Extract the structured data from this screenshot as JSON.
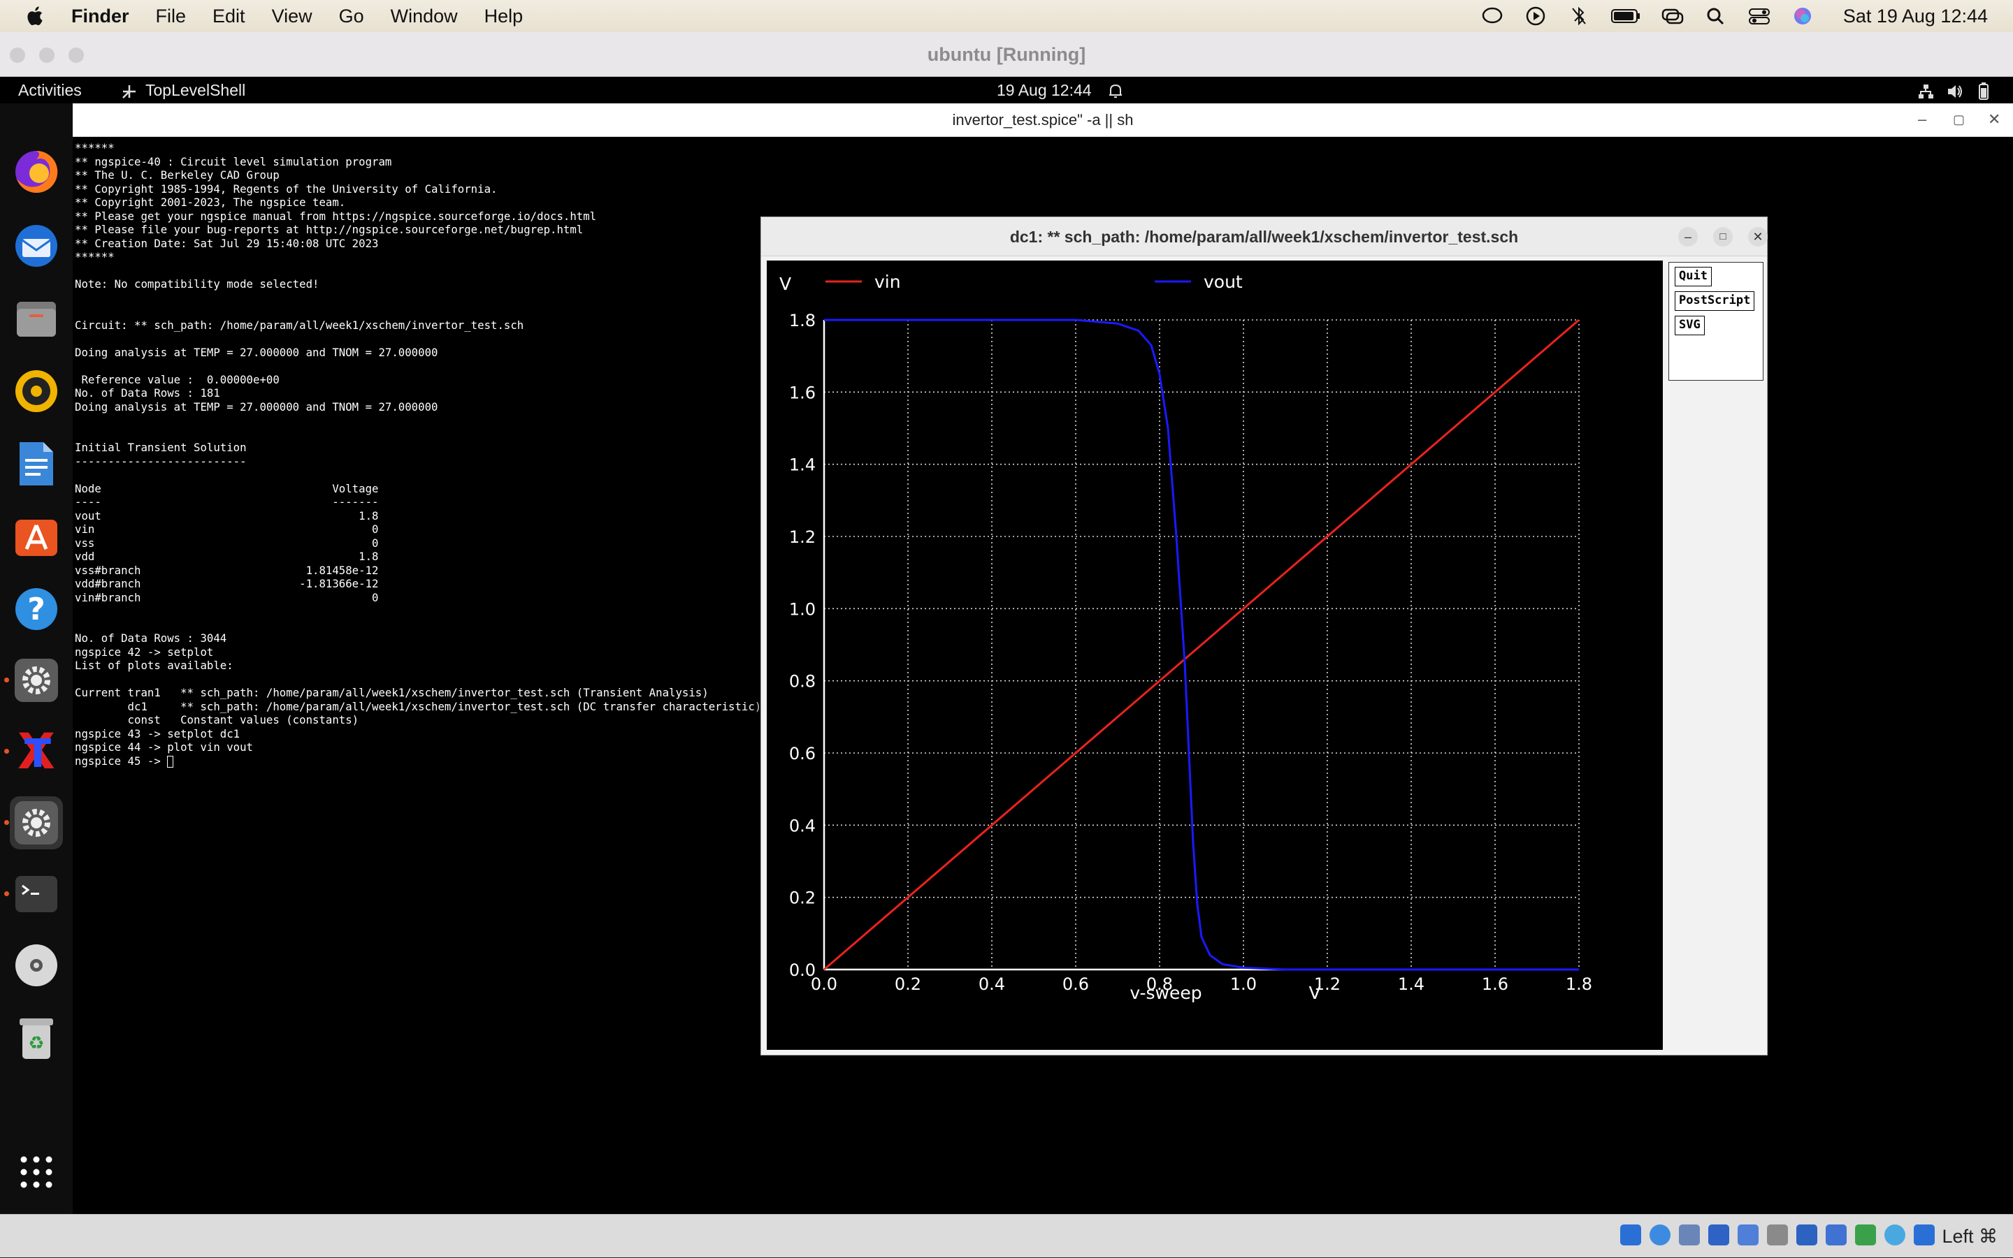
{
  "mac_menubar": {
    "app": "Finder",
    "menus": [
      "File",
      "Edit",
      "View",
      "Go",
      "Window",
      "Help"
    ],
    "clock": "Sat 19 Aug  12:44"
  },
  "vbox": {
    "title": "ubuntu [Running]",
    "host_key": "Left ⌘"
  },
  "ubuntu_panel": {
    "activities": "Activities",
    "app_name": "TopLevelShell",
    "datetime": "19 Aug  12:44"
  },
  "dock": {
    "icons": [
      "firefox-icon",
      "thunderbird-icon",
      "files-icon",
      "rhythmbox-icon",
      "writer-icon",
      "app-center-icon",
      "help-icon",
      "settings-icon",
      "xschem-icon",
      "settings-icon-2",
      "terminal-icon",
      "dvd-icon",
      "trash-icon",
      "app-grid-icon"
    ]
  },
  "terminal": {
    "title": "invertor_test.spice\" -a || sh",
    "lines": [
      "******",
      "** ngspice-40 : Circuit level simulation program",
      "** The U. C. Berkeley CAD Group",
      "** Copyright 1985-1994, Regents of the University of California.",
      "** Copyright 2001-2023, The ngspice team.",
      "** Please get your ngspice manual from https://ngspice.sourceforge.io/docs.html",
      "** Please file your bug-reports at http://ngspice.sourceforge.net/bugrep.html",
      "** Creation Date: Sat Jul 29 15:40:08 UTC 2023",
      "******",
      "",
      "Note: No compatibility mode selected!",
      "",
      "",
      "Circuit: ** sch_path: /home/param/all/week1/xschem/invertor_test.sch",
      "",
      "Doing analysis at TEMP = 27.000000 and TNOM = 27.000000",
      "",
      " Reference value :  0.00000e+00",
      "No. of Data Rows : 181",
      "Doing analysis at TEMP = 27.000000 and TNOM = 27.000000",
      "",
      "",
      "Initial Transient Solution",
      "--------------------------",
      "",
      "Node                                   Voltage",
      "----                                   -------",
      "vout                                       1.8",
      "vin                                          0",
      "vss                                          0",
      "vdd                                        1.8",
      "vss#branch                         1.81458e-12",
      "vdd#branch                        -1.81366e-12",
      "vin#branch                                   0",
      "",
      "",
      "No. of Data Rows : 3044",
      "ngspice 42 -> setplot",
      "List of plots available:",
      "",
      "Current tran1   ** sch_path: /home/param/all/week1/xschem/invertor_test.sch (Transient Analysis)",
      "        dc1     ** sch_path: /home/param/all/week1/xschem/invertor_test.sch (DC transfer characteristic)",
      "        const   Constant values (constants)",
      "ngspice 43 -> setplot dc1",
      "ngspice 44 -> plot vin vout",
      "ngspice 45 -> "
    ]
  },
  "plot_window": {
    "title": "dc1: ** sch_path: /home/param/all/week1/xschem/invertor_test.sch",
    "buttons": {
      "quit": "Quit",
      "postscript": "PostScript",
      "svg": "SVG"
    }
  },
  "chart_data": {
    "type": "line",
    "ylabel": "V",
    "xlabel": "v-sweep",
    "xunit": "V",
    "xlim": [
      0.0,
      1.8
    ],
    "ylim": [
      0.0,
      1.8
    ],
    "xticks": [
      "0.0",
      "0.2",
      "0.4",
      "0.6",
      "0.8",
      "1.0",
      "1.2",
      "1.4",
      "1.6",
      "1.8"
    ],
    "yticks": [
      "0.0",
      "0.2",
      "0.4",
      "0.6",
      "0.8",
      "1.0",
      "1.2",
      "1.4",
      "1.6",
      "1.8"
    ],
    "grid": true,
    "legend_placement": "top",
    "series": [
      {
        "name": "vin",
        "color": "#e8231e",
        "x": [
          0.0,
          1.8
        ],
        "y": [
          0.0,
          1.8
        ]
      },
      {
        "name": "vout",
        "color": "#1a1aff",
        "x": [
          0.0,
          0.6,
          0.7,
          0.75,
          0.78,
          0.8,
          0.82,
          0.84,
          0.86,
          0.87,
          0.88,
          0.89,
          0.9,
          0.92,
          0.95,
          1.0,
          1.1,
          1.2,
          1.8
        ],
        "y": [
          1.8,
          1.8,
          1.79,
          1.77,
          1.73,
          1.65,
          1.5,
          1.2,
          0.85,
          0.6,
          0.35,
          0.18,
          0.09,
          0.04,
          0.015,
          0.005,
          0.0,
          0.0,
          0.0
        ]
      }
    ]
  }
}
